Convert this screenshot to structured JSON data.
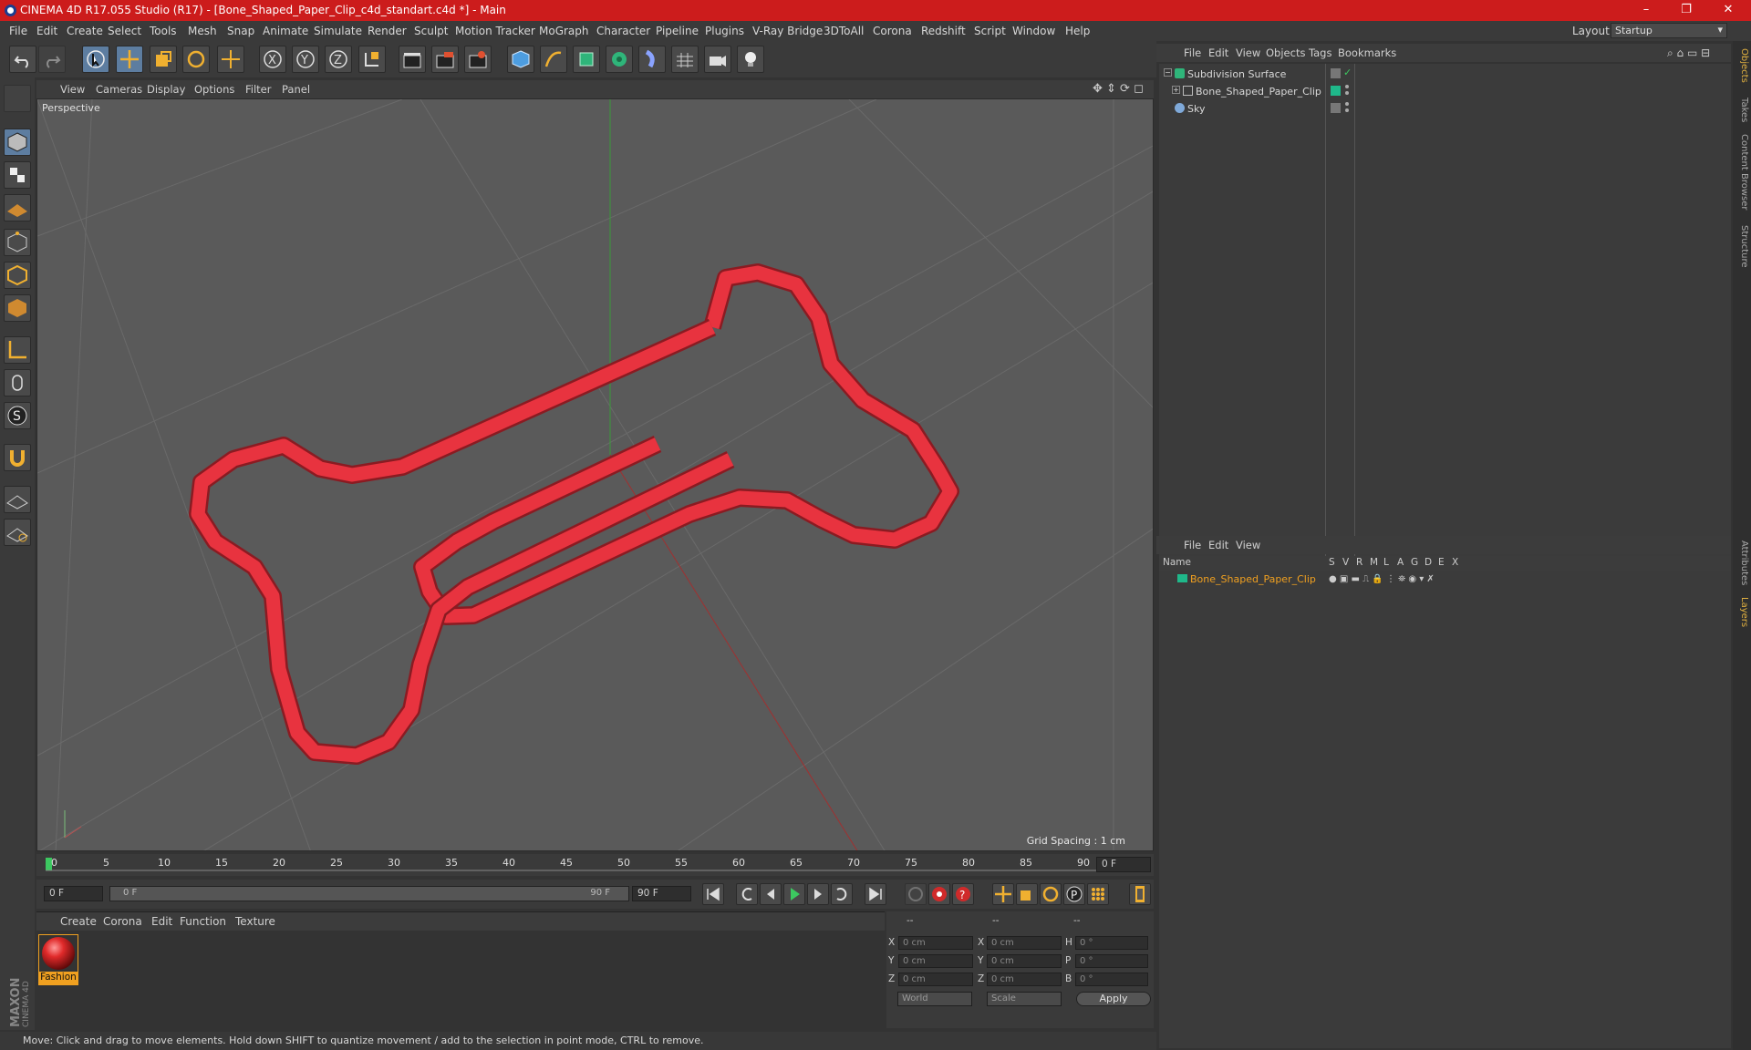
{
  "window": {
    "title": "CINEMA 4D R17.055 Studio (R17) - [Bone_Shaped_Paper_Clip_c4d_standart.c4d *] - Main",
    "controls": [
      "–",
      "❐",
      "✕"
    ]
  },
  "menubar": {
    "items": [
      "File",
      "Edit",
      "Create",
      "Select",
      "Tools",
      "Mesh",
      "Snap",
      "Animate",
      "Simulate",
      "Render",
      "Sculpt",
      "Motion Tracker",
      "MoGraph",
      "Character",
      "Pipeline",
      "Plugins",
      "V-Ray Bridge",
      "3DToAll",
      "Corona",
      "Redshift",
      "Script",
      "Window",
      "Help"
    ],
    "layout_label": "Layout:",
    "layout_value": "Startup"
  },
  "viewport": {
    "menu": [
      "View",
      "Cameras",
      "Display",
      "Options",
      "Filter",
      "Panel"
    ],
    "label": "Perspective",
    "grid_spacing": "Grid Spacing : 1 cm"
  },
  "timeline": {
    "ticks": [
      "0",
      "5",
      "10",
      "15",
      "20",
      "25",
      "30",
      "35",
      "40",
      "45",
      "50",
      "55",
      "60",
      "65",
      "70",
      "75",
      "80",
      "85",
      "90"
    ],
    "current_frame": "0 F"
  },
  "playbar": {
    "start_field": "0 F",
    "range_start": "0 F",
    "range_end": "90 F",
    "end_field": "90 F"
  },
  "materials": {
    "menu": [
      "Create",
      "Corona",
      "Edit",
      "Function",
      "Texture"
    ],
    "items": [
      {
        "name": "Fashion"
      }
    ]
  },
  "coordinates": {
    "headers": [
      "--",
      "--",
      "--"
    ],
    "rows": [
      {
        "axis": "X",
        "pos": "0 cm",
        "axis2": "X",
        "size": "0 cm",
        "rot_axis": "H",
        "rot": "0 °"
      },
      {
        "axis": "Y",
        "pos": "0 cm",
        "axis2": "Y",
        "size": "0 cm",
        "rot_axis": "P",
        "rot": "0 °"
      },
      {
        "axis": "Z",
        "pos": "0 cm",
        "axis2": "Z",
        "size": "0 cm",
        "rot_axis": "B",
        "rot": "0 °"
      }
    ],
    "mode": "World",
    "scale": "Scale",
    "apply": "Apply"
  },
  "object_manager": {
    "menu": [
      "File",
      "Edit",
      "View",
      "Objects",
      "Tags",
      "Bookmarks"
    ],
    "objects": [
      {
        "name": "Subdivision Surface"
      },
      {
        "name": "Bone_Shaped_Paper_Clip"
      },
      {
        "name": "Sky"
      }
    ]
  },
  "layer_manager": {
    "menu": [
      "File",
      "Edit",
      "View"
    ],
    "columns": [
      "Name",
      "S",
      "V",
      "R",
      "M",
      "L",
      "A",
      "G",
      "D",
      "E",
      "X"
    ],
    "layers": [
      {
        "name": "Bone_Shaped_Paper_Clip"
      }
    ]
  },
  "side_tabs": [
    "Objects",
    "Takes",
    "Content Browser",
    "Structure",
    "Attributes",
    "Layers"
  ],
  "brand": "MAXON CINEMA 4D",
  "status": "Move: Click and drag to move elements. Hold down SHIFT to quantize movement / add to the selection in point mode, CTRL to remove.",
  "colors": {
    "title_bar": "#cc1c1c",
    "clip_red": "#e8333f",
    "layer_green": "#1fb88a",
    "highlight_orange": "#f0a020"
  }
}
